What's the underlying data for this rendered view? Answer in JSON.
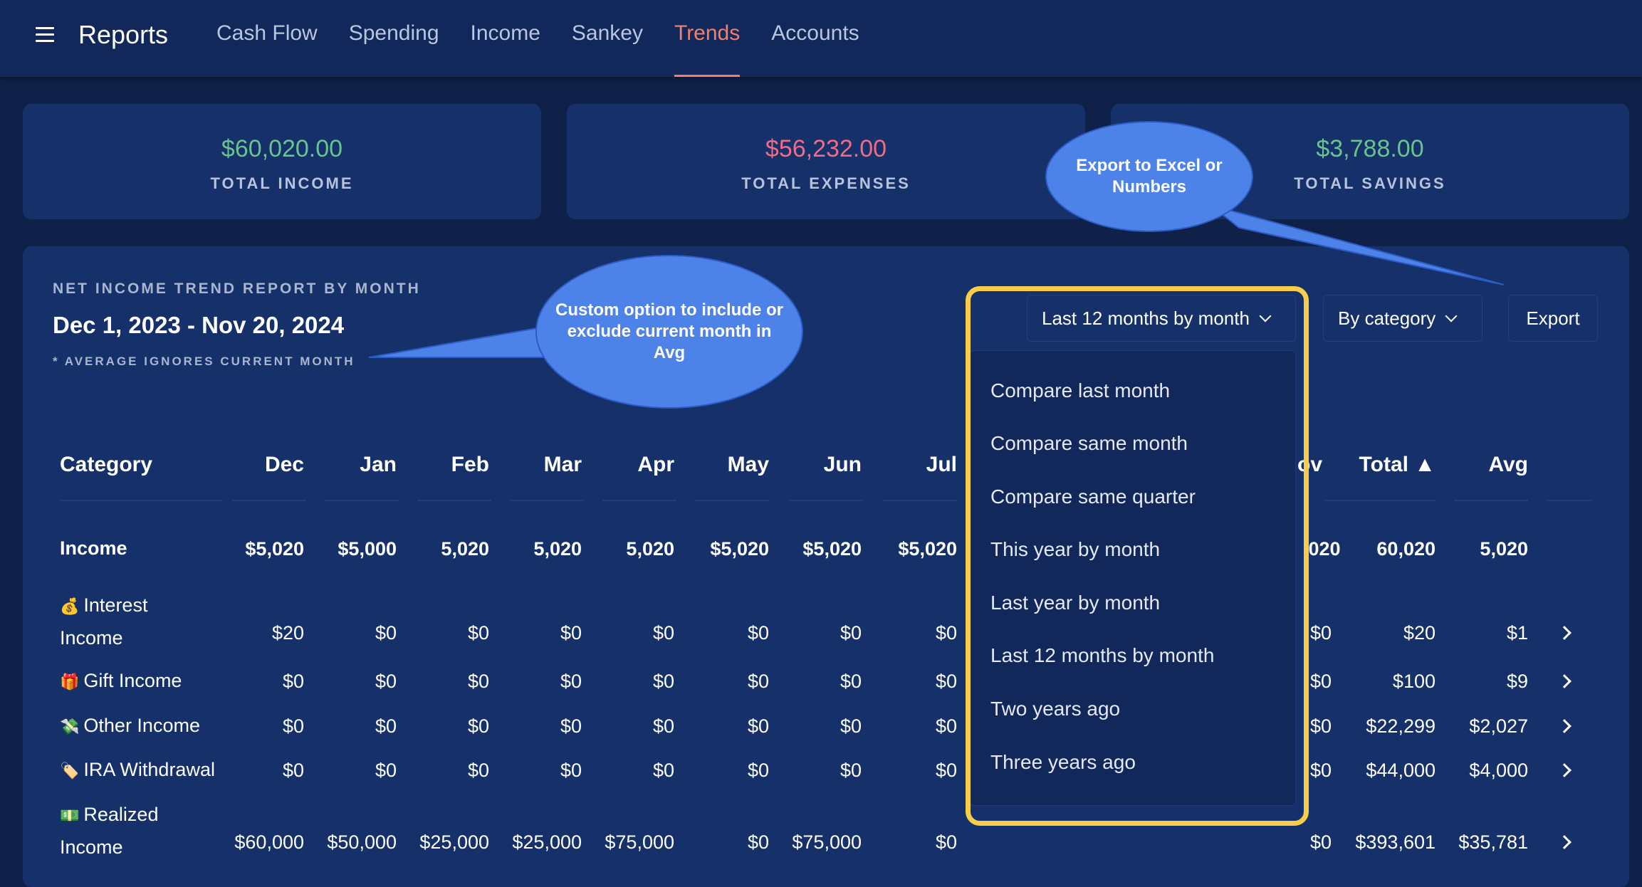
{
  "header": {
    "title": "Reports",
    "nav": [
      {
        "label": "Cash Flow",
        "active": false
      },
      {
        "label": "Spending",
        "active": false
      },
      {
        "label": "Income",
        "active": false
      },
      {
        "label": "Sankey",
        "active": false
      },
      {
        "label": "Trends",
        "active": true
      },
      {
        "label": "Accounts",
        "active": false
      }
    ]
  },
  "summary": {
    "income": {
      "value": "$60,020.00",
      "label": "TOTAL INCOME"
    },
    "expenses": {
      "value": "$56,232.00",
      "label": "TOTAL EXPENSES"
    },
    "savings": {
      "value": "$3,788.00",
      "label": "TOTAL SAVINGS"
    }
  },
  "report": {
    "kicker": "NET INCOME TREND REPORT BY MONTH",
    "dates": "Dec 1, 2023 - Nov 20, 2024",
    "note": "* AVERAGE IGNORES CURRENT MONTH"
  },
  "controls": {
    "period": "Last 12 months by month",
    "grouping": "By category",
    "export": "Export"
  },
  "dropdown": {
    "options": [
      "Compare last month",
      "Compare same month",
      "Compare same quarter",
      "This year by month",
      "Last year by month",
      "Last 12 months by month",
      "Two years ago",
      "Three years ago"
    ]
  },
  "table": {
    "headers": [
      "Category",
      "Dec",
      "Jan",
      "Feb",
      "Mar",
      "Apr",
      "May",
      "Jun",
      "Jul",
      "Nov",
      "Total ▲",
      "Avg"
    ],
    "header_partial_nov": "ov",
    "rows": [
      {
        "name": "Income",
        "emoji": "",
        "line2": "",
        "bold": true,
        "vals": [
          "$5,020",
          "$5,000",
          "5,020",
          "5,020",
          "5,020",
          "$5,020",
          "$5,020",
          "$5,020"
        ],
        "nov": ",020",
        "total": "60,020",
        "avg": "5,020"
      },
      {
        "name": "Interest",
        "emoji": "💰",
        "line2": "Income",
        "bold": false,
        "vals": [
          "$20",
          "$0",
          "$0",
          "$0",
          "$0",
          "$0",
          "$0",
          "$0"
        ],
        "nov": "$0",
        "total": "$20",
        "avg": "$1"
      },
      {
        "name": "Gift Income",
        "emoji": "🎁",
        "line2": "",
        "bold": false,
        "vals": [
          "$0",
          "$0",
          "$0",
          "$0",
          "$0",
          "$0",
          "$0",
          "$0"
        ],
        "nov": "$0",
        "total": "$100",
        "avg": "$9"
      },
      {
        "name": "Other Income",
        "emoji": "💸",
        "line2": "",
        "bold": false,
        "vals": [
          "$0",
          "$0",
          "$0",
          "$0",
          "$0",
          "$0",
          "$0",
          "$0"
        ],
        "nov": "$0",
        "total": "$22,299",
        "avg": "$2,027"
      },
      {
        "name": "IRA Withdrawal",
        "emoji": "🏷️",
        "line2": "",
        "bold": false,
        "vals": [
          "$0",
          "$0",
          "$0",
          "$0",
          "$0",
          "$0",
          "$0",
          "$0"
        ],
        "nov": "$0",
        "total": "$44,000",
        "avg": "$4,000"
      },
      {
        "name": "Realized",
        "emoji": "💵",
        "line2": "Income",
        "bold": false,
        "vals": [
          "$60,000",
          "$50,000",
          "$25,000",
          "$25,000",
          "$75,000",
          "$0",
          "$75,000",
          "$0"
        ],
        "nov": "$0",
        "total": "$393,601",
        "avg": "$35,781"
      }
    ]
  },
  "annotations": {
    "export_note": "Export to Excel or Numbers",
    "avg_note": "Custom option to include or exclude current month in Avg"
  },
  "colors": {
    "background": "#0f2148",
    "card": "#16306a",
    "accent": "#f07f6c",
    "positive": "#67c48f",
    "negative": "#f06b86",
    "highlight": "#f7cd4a",
    "callout": "#4d82e8"
  }
}
